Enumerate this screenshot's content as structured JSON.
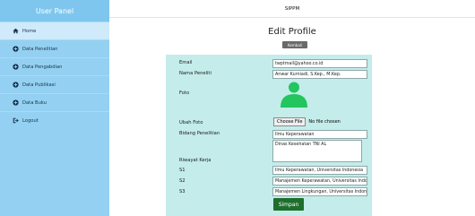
{
  "sidebar": {
    "title": "User Panel",
    "items": [
      {
        "label": "Home",
        "icon": "home-icon"
      },
      {
        "label": "Data Penelitian",
        "icon": "plus-circle-icon"
      },
      {
        "label": "Data Pengabdian",
        "icon": "plus-circle-icon"
      },
      {
        "label": "Data Publikasi",
        "icon": "plus-circle-icon"
      },
      {
        "label": "Data Buku",
        "icon": "plus-circle-icon"
      },
      {
        "label": "Logout",
        "icon": "logout-icon"
      }
    ]
  },
  "topbar": {
    "title": "SIPPM"
  },
  "page": {
    "title": "Edit Profile",
    "back_label": "Kembali"
  },
  "form": {
    "email_label": "Email",
    "email_value": "twptmail@yahoo.co.id",
    "nama_label": "Nama Peneliti",
    "nama_value": "Anwar Kurniadi, S.Kep., M.Kep.",
    "foto_label": "Foto",
    "ubah_foto_label": "Ubah Foto",
    "file_button": "Choose File",
    "file_status": "No file chosen",
    "bidang_label": "Bidang Penelitian",
    "bidang_value": "Ilmu Keperawatan",
    "riwayat_value": "Dinas Kesehatan TNI AL",
    "riwayat_label": "Riwayat Kerja",
    "s1_label": "S1",
    "s1_value": "Ilmu Keperawatan, Universitas Indonesia",
    "s2_label": "S2",
    "s2_value": "Manajemen Keperawatan, Universitas Indonesia",
    "s3_label": "S3",
    "s3_value": "Manajemen Lingkungan, Universitas Indonesia",
    "save_label": "Simpan"
  },
  "colors": {
    "sidebar": "#94d0f2",
    "panel": "#c3ecea",
    "save_button": "#1e6f2c",
    "avatar": "#22c55e"
  }
}
